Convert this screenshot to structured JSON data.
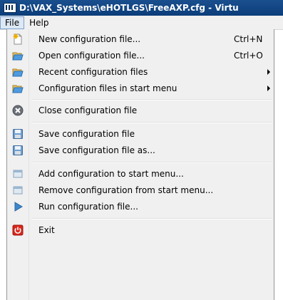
{
  "window": {
    "title": "D:\\VAX_Systems\\eHOTLGS\\FreeAXP.cfg - Virtu",
    "icon": "app-icon"
  },
  "menubar": {
    "items": [
      {
        "label": "File",
        "active": true
      },
      {
        "label": "Help",
        "active": false
      }
    ]
  },
  "file_menu": {
    "items": [
      {
        "label": "New configuration file...",
        "shortcut": "Ctrl+N",
        "icon": "new-file-icon"
      },
      {
        "label": "Open configuration file...",
        "shortcut": "Ctrl+O",
        "icon": "open-folder-icon"
      },
      {
        "label": "Recent configuration files",
        "submenu": true,
        "icon": "open-folder-icon"
      },
      {
        "label": "Configuration files in start menu",
        "submenu": true,
        "icon": "open-folder-icon"
      },
      {
        "label": "Close configuration file",
        "icon": "close-icon"
      },
      {
        "label": "Save configuration file",
        "icon": "floppy-disk-icon"
      },
      {
        "label": "Save configuration file as...",
        "icon": "floppy-disk-icon"
      },
      {
        "label": "Add configuration to start menu...",
        "icon": "start-menu-icon"
      },
      {
        "label": "Remove configuration from start menu...",
        "icon": "start-menu-icon"
      },
      {
        "label": "Run configuration file...",
        "icon": "run-icon"
      },
      {
        "label": "Exit",
        "icon": "power-icon"
      }
    ]
  }
}
